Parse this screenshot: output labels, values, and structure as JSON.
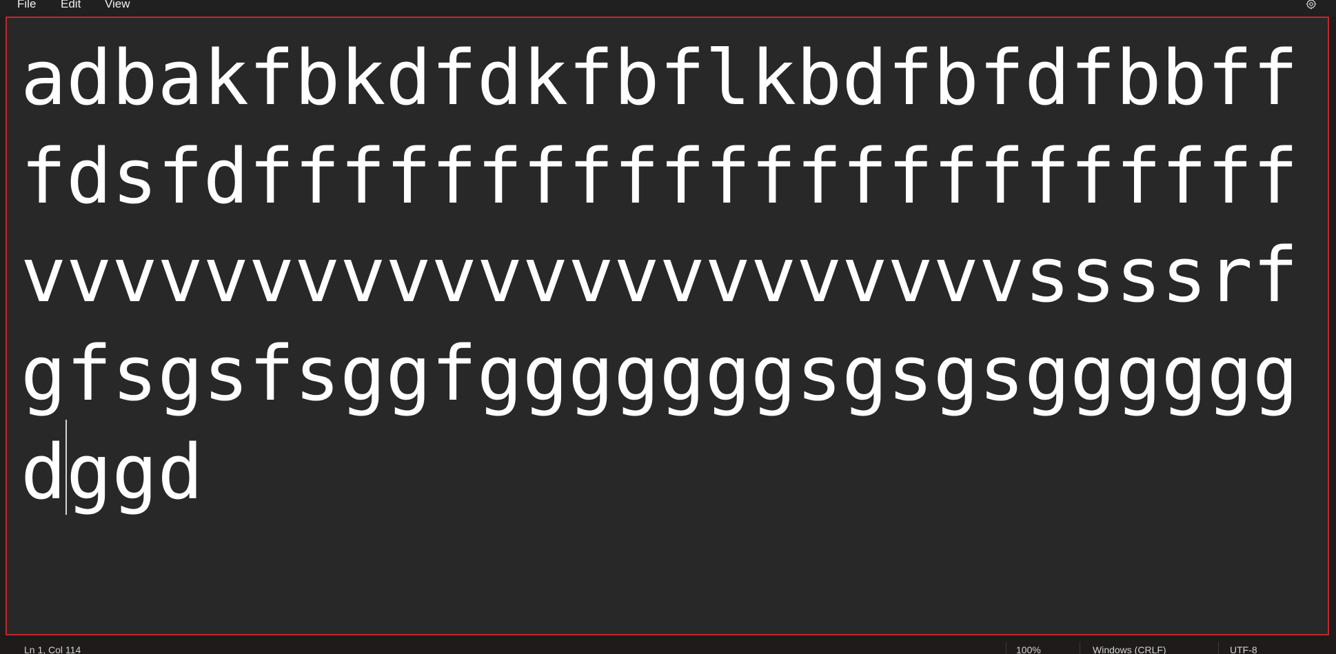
{
  "menu": {
    "items": [
      {
        "label": "File"
      },
      {
        "label": "Edit"
      },
      {
        "label": "View"
      }
    ]
  },
  "icons": {
    "settings": "gear-icon"
  },
  "editor": {
    "content": "adbakfbkdfdkfbflkbdfbfdfbbfffdsfdfffffffffffffffffffffffvvvvvvvvvvvvvvvvvvvvvvssssrfgfsgsfsggfgggggggsgsgsggggggdggd"
  },
  "status": {
    "position": "Ln 1, Col 114",
    "zoom": "100%",
    "line_ending": "Windows (CRLF)",
    "encoding": "UTF-8"
  },
  "colors": {
    "editor_background": "#282828",
    "frame_border": "#c4262d",
    "text": "#ffffff"
  }
}
